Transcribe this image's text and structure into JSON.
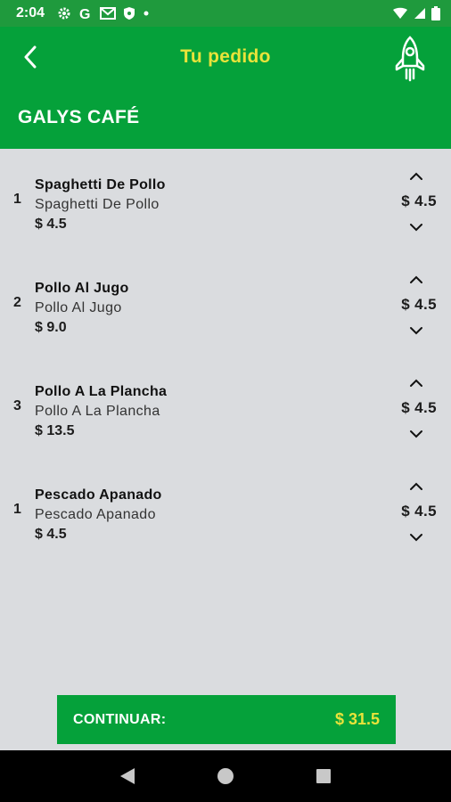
{
  "status_bar": {
    "time": "2:04",
    "left_icons": [
      "settings-icon",
      "google-icon",
      "gmail-icon",
      "shield-icon",
      "dot-icon"
    ],
    "right_icons": [
      "wifi-icon",
      "signal-icon",
      "battery-icon"
    ]
  },
  "header": {
    "title": "Tu pedido",
    "back_icon": "chevron-left-icon",
    "action_icon": "rocket-icon",
    "restaurant": "GALYS CAFÉ"
  },
  "items": [
    {
      "qty": "1",
      "name": "Spaghetti De Pollo",
      "description": "Spaghetti De Pollo",
      "subtotal": "$ 4.5",
      "unit_price": "$ 4.5"
    },
    {
      "qty": "2",
      "name": "Pollo Al Jugo",
      "description": "Pollo Al Jugo",
      "subtotal": "$ 9.0",
      "unit_price": "$ 4.5"
    },
    {
      "qty": "3",
      "name": "Pollo A La Plancha",
      "description": "Pollo A La Plancha",
      "subtotal": "$ 13.5",
      "unit_price": "$ 4.5"
    },
    {
      "qty": "1",
      "name": "Pescado Apanado",
      "description": "Pescado Apanado",
      "subtotal": "$ 4.5",
      "unit_price": "$ 4.5"
    }
  ],
  "footer": {
    "continue_label": "CONTINUAR:",
    "total": "$ 31.5"
  },
  "colors": {
    "primary_green": "#05a13a",
    "accent_yellow": "#e9e33a",
    "background": "#dadcdf"
  }
}
